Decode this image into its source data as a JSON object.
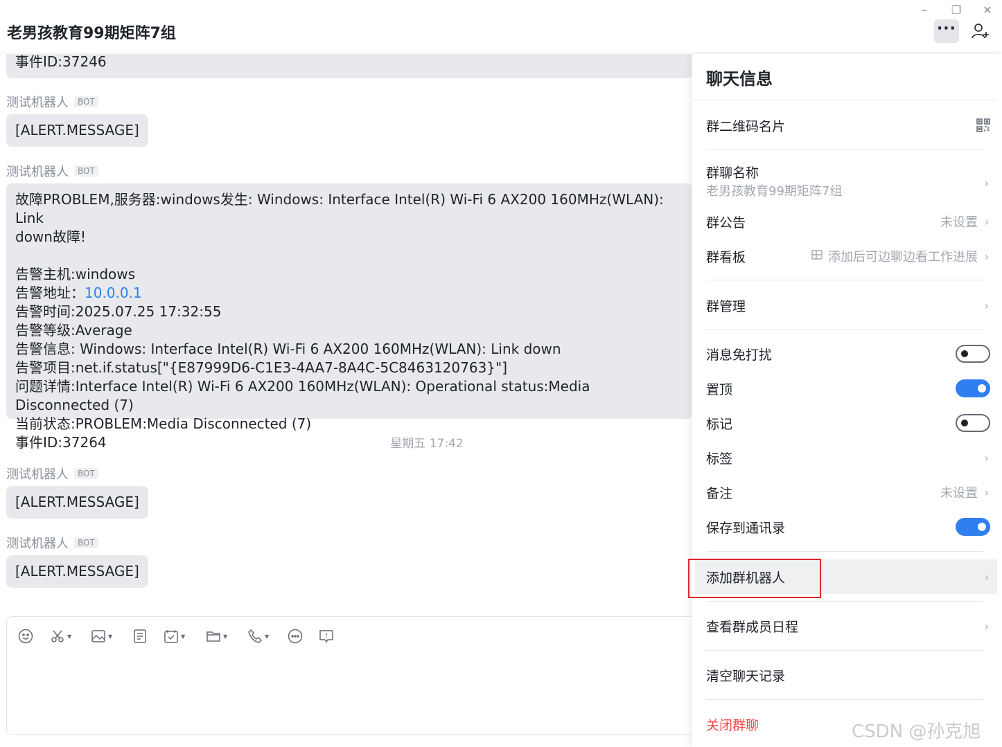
{
  "window": {
    "title": "老男孩教育99期矩阵7组",
    "minimize_glyph": "–",
    "restore_glyph": "❐",
    "close_glyph": "✕",
    "more_glyph": "···"
  },
  "chat": {
    "partial_top_message": "事件ID:37246",
    "messages": [
      {
        "sender": "测试机器人",
        "tag": "BOT",
        "text": "[ALERT.MESSAGE]"
      },
      {
        "sender": "测试机器人",
        "tag": "BOT",
        "lines": [
          "故障PROBLEM,服务器:windows发生: Windows: Interface Intel(R) Wi-Fi 6 AX200 160MHz(WLAN): Link",
          "down故障!",
          "",
          "告警主机:windows",
          "告警地址：",
          "告警时间:2025.07.25 17:32:55",
          "告警等级:Average",
          "告警信息: Windows: Interface Intel(R) Wi-Fi 6 AX200 160MHz(WLAN): Link down",
          "告警项目:net.if.status[\"{E87999D6-C1E3-4AA7-8A4C-5C8463120763}\"]",
          "问题详情:Interface Intel(R) Wi-Fi 6 AX200 160MHz(WLAN): Operational status:Media Disconnected (7)",
          "当前状态:PROBLEM:Media Disconnected (7)",
          "事件ID:37264"
        ],
        "address_link": "10.0.0.1"
      },
      {
        "sender": "测试机器人",
        "tag": "BOT",
        "text": "[ALERT.MESSAGE]"
      },
      {
        "sender": "测试机器人",
        "tag": "BOT",
        "text": "[ALERT.MESSAGE]"
      }
    ],
    "time_separator": "星期五 17:42"
  },
  "composer": {
    "tools": [
      "emoji-icon",
      "screenshot-icon",
      "image-icon",
      "doc-icon",
      "task-icon",
      "folder-icon",
      "phone-icon",
      "more-icon",
      "feedback-icon"
    ]
  },
  "panel": {
    "title": "聊天信息",
    "qr_label": "群二维码名片",
    "group_name_label": "群聊名称",
    "group_name_value": "老男孩教育99期矩阵7组",
    "announcement_label": "群公告",
    "announcement_value": "未设置",
    "board_label": "群看板",
    "board_value": "添加后可边聊边看工作进展",
    "manage_label": "群管理",
    "mute_label": "消息免打扰",
    "mute_on": false,
    "pin_label": "置顶",
    "pin_on": true,
    "mark_label": "标记",
    "mark_on": false,
    "tags_label": "标签",
    "remark_label": "备注",
    "remark_value": "未设置",
    "save_contacts_label": "保存到通讯录",
    "save_contacts_on": true,
    "add_bot_label": "添加群机器人",
    "schedule_label": "查看群成员日程",
    "clear_history_label": "清空聊天记录",
    "leave_label": "关闭群聊"
  },
  "watermark": "CSDN @孙克旭",
  "colors": {
    "accent": "#2f7ff0",
    "danger": "#f54a45",
    "highlight_box": "#e0252b"
  }
}
